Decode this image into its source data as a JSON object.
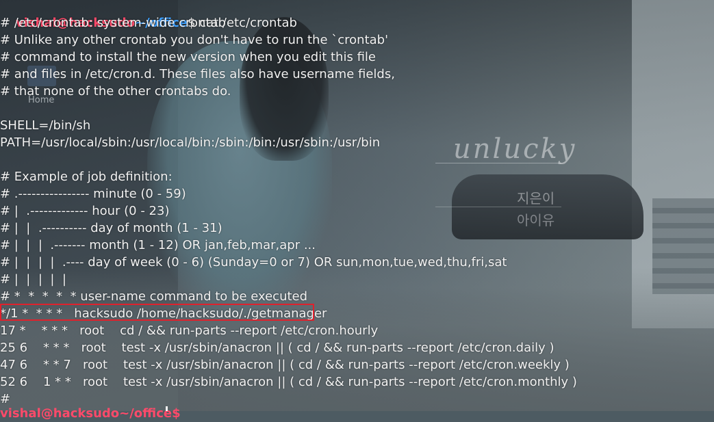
{
  "prompt": {
    "user": "vishal",
    "at": "@",
    "host": "hacksudo",
    "path": "~/office",
    "symbol": "$",
    "command": "cat /etc/crontab"
  },
  "wallpaper": {
    "desktop_label": "Home",
    "watermark_title": "unlucky",
    "watermark_line1": "지은이",
    "watermark_line2": "아이유"
  },
  "output": {
    "lines": [
      "# /etc/crontab: system-wide crontab",
      "# Unlike any other crontab you don't have to run the `crontab'",
      "# command to install the new version when you edit this file",
      "# and files in /etc/cron.d. These files also have username fields,",
      "# that none of the other crontabs do.",
      "",
      "SHELL=/bin/sh",
      "PATH=/usr/local/sbin:/usr/local/bin:/sbin:/bin:/usr/sbin:/usr/bin",
      "",
      "# Example of job definition:",
      "# .---------------- minute (0 - 59)",
      "# |  .------------- hour (0 - 23)",
      "# |  |  .---------- day of month (1 - 31)",
      "# |  |  |  .------- month (1 - 12) OR jan,feb,mar,apr ...",
      "# |  |  |  |  .---- day of week (0 - 6) (Sunday=0 or 7) OR sun,mon,tue,wed,thu,fri,sat",
      "# |  |  |  |  |",
      "# *  *  *  *  * user-name command to be executed",
      "*/1 *  * * *   hacksudo /home/hacksudo/./getmanager",
      "17 *    * * *   root    cd / && run-parts --report /etc/cron.hourly",
      "25 6    * * *   root    test -x /usr/sbin/anacron || ( cd / && run-parts --report /etc/cron.daily )",
      "47 6    * * 7   root    test -x /usr/sbin/anacron || ( cd / && run-parts --report /etc/cron.weekly )",
      "52 6    1 * *   root    test -x /usr/sbin/anacron || ( cd / && run-parts --report /etc/cron.monthly )",
      "#"
    ]
  },
  "next_prompt": "vishal@hacksudo~/office$"
}
